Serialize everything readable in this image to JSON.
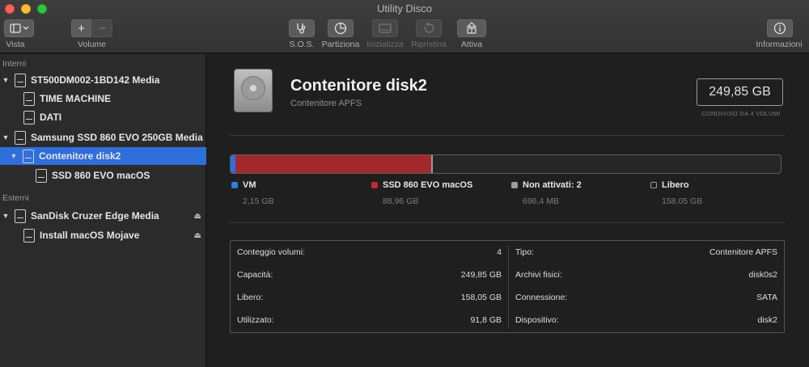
{
  "window": {
    "title": "Utility Disco"
  },
  "toolbar": {
    "view_label": "Vista",
    "volume_label": "Volume",
    "add_symbol": "+",
    "remove_symbol": "−",
    "sos_label": "S.O.S.",
    "partition_label": "Partiziona",
    "erase_label": "Inizializza",
    "restore_label": "Ripristina",
    "mount_label": "Attiva",
    "info_label": "Informazioni"
  },
  "sidebar": {
    "internal_header": "Interni",
    "external_header": "Esterni",
    "items": [
      {
        "label": "ST500DM002-1BD142 Media",
        "level": 0,
        "disclosure": "▼"
      },
      {
        "label": "TIME MACHINE",
        "level": 1
      },
      {
        "label": "DATI",
        "level": 1
      },
      {
        "label": "Samsung SSD 860 EVO 250GB Media",
        "level": 0,
        "disclosure": "▼"
      },
      {
        "label": "Contenitore disk2",
        "level": 1,
        "disclosure": "▼",
        "selected": true
      },
      {
        "label": "SSD 860 EVO macOS",
        "level": 2
      },
      {
        "label": "SanDisk Cruzer Edge Media",
        "level": 0,
        "disclosure": "▼",
        "eject": "⏏"
      },
      {
        "label": "Install macOS Mojave",
        "level": 1,
        "eject": "⏏"
      }
    ]
  },
  "volume": {
    "title": "Contenitore disk2",
    "subtitle": "Contenitore APFS",
    "size": "249,85 GB",
    "size_note": "CONDIVISO DA 4 VOLUMI"
  },
  "usage": {
    "segments": [
      {
        "name": "VM",
        "fraction": 0.0086,
        "color": "#2f6fdb"
      },
      {
        "name": "SSD 860 EVO macOS",
        "fraction": 0.356,
        "color": "#a3282c"
      },
      {
        "name": "Non attivati: 2",
        "fraction": 0.0028,
        "color": "#9a9a9a"
      }
    ],
    "legend": [
      {
        "name": "VM",
        "value": "2,15 GB",
        "color": "#2f7fe0"
      },
      {
        "name": "SSD 860 EVO macOS",
        "value": "88,96 GB",
        "color": "#c2272d"
      },
      {
        "name": "Non attivati: 2",
        "value": "696,4 MB",
        "color": "#9c9c9c"
      },
      {
        "name": "Libero",
        "value": "158,05 GB",
        "color": "#1f1f1f"
      }
    ]
  },
  "info": {
    "left": [
      {
        "label": "Conteggio volumi:",
        "value": "4"
      },
      {
        "label": "Capacità:",
        "value": "249,85 GB"
      },
      {
        "label": "Libero:",
        "value": "158,05 GB"
      },
      {
        "label": "Utilizzato:",
        "value": "91,8 GB"
      }
    ],
    "right": [
      {
        "label": "Tipo:",
        "value": "Contenitore APFS"
      },
      {
        "label": "Archivi fisici:",
        "value": "disk0s2"
      },
      {
        "label": "Connessione:",
        "value": "SATA"
      },
      {
        "label": "Dispositivo:",
        "value": "disk2"
      }
    ]
  }
}
